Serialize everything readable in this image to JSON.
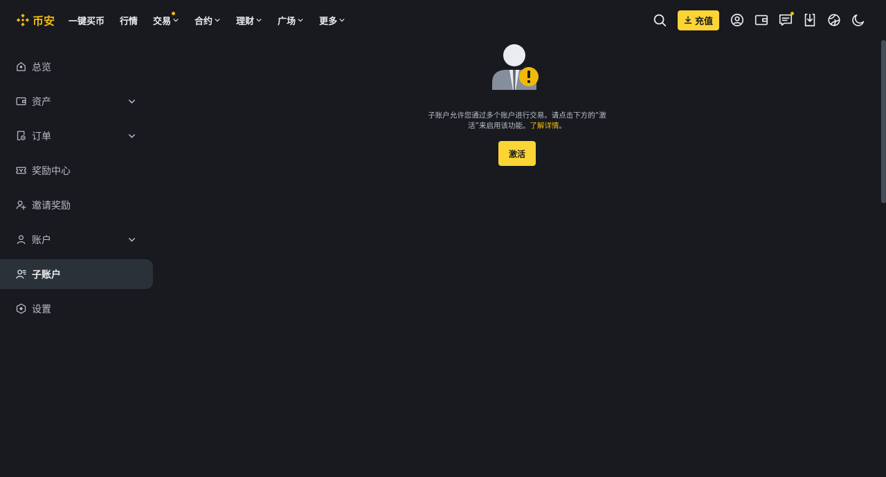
{
  "header": {
    "brand": "币安",
    "nav": [
      {
        "label": "一键买币",
        "has_dropdown": false,
        "has_dot": false
      },
      {
        "label": "行情",
        "has_dropdown": false,
        "has_dot": false
      },
      {
        "label": "交易",
        "has_dropdown": true,
        "has_dot": true
      },
      {
        "label": "合约",
        "has_dropdown": true,
        "has_dot": false
      },
      {
        "label": "理财",
        "has_dropdown": true,
        "has_dot": false
      },
      {
        "label": "广场",
        "has_dropdown": true,
        "has_dot": false
      },
      {
        "label": "更多",
        "has_dropdown": true,
        "has_dot": false
      }
    ],
    "deposit_label": "充值",
    "tool_icons": [
      "search-icon",
      "download-icon",
      "user-circle-icon",
      "wallet-icon",
      "message-icon",
      "app-download-icon",
      "globe-icon",
      "moon-icon"
    ]
  },
  "sidebar": {
    "items": [
      {
        "label": "总览",
        "icon": "home-icon",
        "expandable": false,
        "active": false
      },
      {
        "label": "资产",
        "icon": "wallet-icon",
        "expandable": true,
        "active": false
      },
      {
        "label": "订单",
        "icon": "order-icon",
        "expandable": true,
        "active": false
      },
      {
        "label": "奖励中心",
        "icon": "ticket-icon",
        "expandable": false,
        "active": false
      },
      {
        "label": "邀请奖励",
        "icon": "user-plus-icon",
        "expandable": false,
        "active": false
      },
      {
        "label": "账户",
        "icon": "user-icon",
        "expandable": true,
        "active": false
      },
      {
        "label": "子账户",
        "icon": "sub-account-icon",
        "expandable": false,
        "active": true
      },
      {
        "label": "设置",
        "icon": "settings-icon",
        "expandable": false,
        "active": false
      }
    ]
  },
  "main": {
    "empty_state": {
      "message": "子账户允许您通过多个账户进行交易。请点击下方的“激活”来启用该功能。",
      "link_label": "了解详情",
      "suffix": "。",
      "activate_label": "激活"
    }
  },
  "colors": {
    "background": "#181A20",
    "accent": "#FCD535",
    "brand": "#F0B90B",
    "active_bg": "#2B3139"
  }
}
